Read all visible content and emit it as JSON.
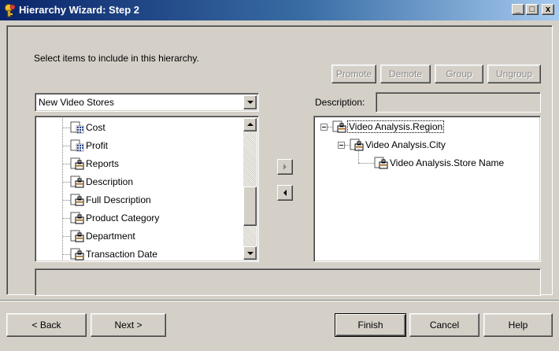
{
  "window": {
    "title": "Hierarchy Wizard: Step 2",
    "icon": "wizard-key-icon",
    "controls": [
      "minimize-icon",
      "maximize-icon",
      "close-icon"
    ]
  },
  "instructions": "Select items to include in this hierarchy.",
  "reorder_buttons": {
    "promote": "Promote",
    "demote": "Demote",
    "group": "Group",
    "ungroup": "Ungroup"
  },
  "description": {
    "label": "Description:",
    "value": ""
  },
  "source_select": {
    "selected": "New Video Stores"
  },
  "available_items": [
    {
      "label": "Cost",
      "icon": "measure-icon"
    },
    {
      "label": "Profit",
      "icon": "measure-icon"
    },
    {
      "label": "Reports",
      "icon": "attribute-icon"
    },
    {
      "label": "Description",
      "icon": "attribute-icon"
    },
    {
      "label": "Full Description",
      "icon": "attribute-icon"
    },
    {
      "label": "Product Category",
      "icon": "attribute-icon"
    },
    {
      "label": "Department",
      "icon": "attribute-icon"
    },
    {
      "label": "Transaction Date",
      "icon": "attribute-icon"
    }
  ],
  "hierarchy_items": [
    {
      "label": "Video Analysis.Region",
      "level": 0,
      "expanded": true,
      "selected": true
    },
    {
      "label": "Video Analysis.City",
      "level": 1,
      "expanded": true
    },
    {
      "label": "Video Analysis.Store Name",
      "level": 2
    }
  ],
  "status_text": "",
  "footer": {
    "back": "< Back",
    "next": "Next >",
    "finish": "Finish",
    "cancel": "Cancel",
    "help": "Help"
  },
  "colors": {
    "titlebar_start": "#0a246a",
    "titlebar_end": "#a6caf0",
    "face": "#d4d0c8",
    "measure_icon": "#1f3c8c",
    "attribute_icon": "#a35a00"
  }
}
